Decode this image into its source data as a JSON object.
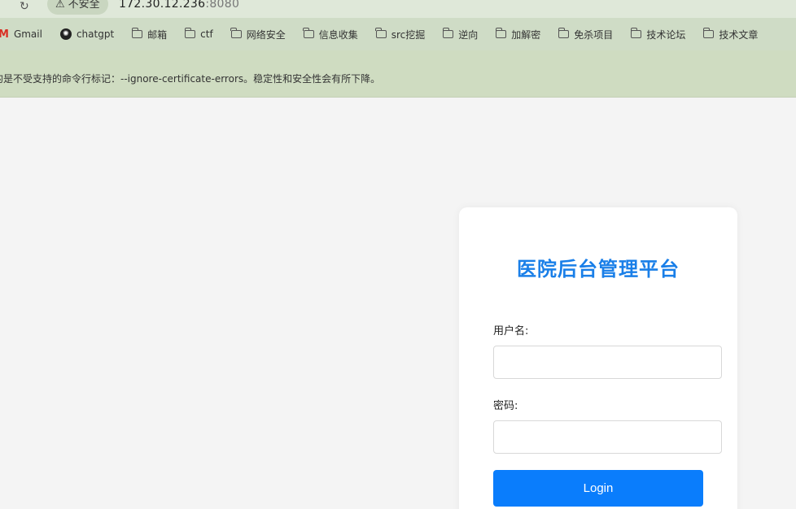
{
  "browser": {
    "security_label": "不安全",
    "url_host": "172.30.12.236",
    "url_port": ":8080",
    "bookmarks": [
      {
        "label": "Gmail",
        "icon": "gmail-icon"
      },
      {
        "label": "chatgpt",
        "icon": "chatgpt-icon"
      },
      {
        "label": "邮箱",
        "icon": "folder-icon"
      },
      {
        "label": "ctf",
        "icon": "folder-icon"
      },
      {
        "label": "网络安全",
        "icon": "folder-icon"
      },
      {
        "label": "信息收集",
        "icon": "folder-icon"
      },
      {
        "label": "src挖掘",
        "icon": "folder-icon"
      },
      {
        "label": "逆向",
        "icon": "folder-icon"
      },
      {
        "label": "加解密",
        "icon": "folder-icon"
      },
      {
        "label": "免杀项目",
        "icon": "folder-icon"
      },
      {
        "label": "技术论坛",
        "icon": "folder-icon"
      },
      {
        "label": "技术文章",
        "icon": "folder-icon"
      }
    ],
    "infobar_text": "的是不受支持的命令行标记：--ignore-certificate-errors。稳定性和安全性会有所下降。"
  },
  "login": {
    "title": "医院后台管理平台",
    "username_label": "用户名:",
    "username_value": "",
    "password_label": "密码:",
    "password_value": "",
    "submit_label": "Login"
  }
}
